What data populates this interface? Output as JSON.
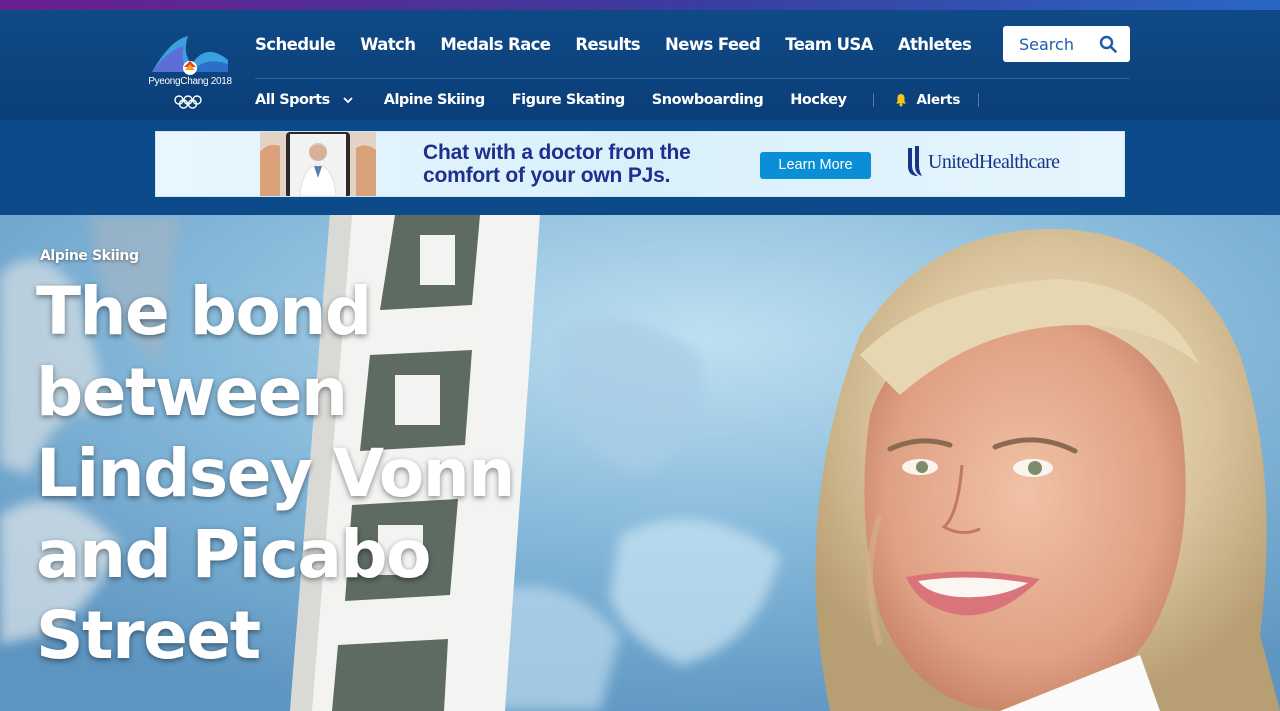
{
  "site": {
    "logo_text": "PyeongChang 2018",
    "colors": {
      "header": "#0b3e78",
      "accent_purple": "#6a1f8f",
      "link_blue": "#1f5ca8"
    }
  },
  "nav": {
    "primary": [
      "Schedule",
      "Watch",
      "Medals Race",
      "Results",
      "News Feed",
      "Team USA",
      "Athletes"
    ],
    "all_sports_label": "All Sports",
    "sports": [
      "Alpine Skiing",
      "Figure Skating",
      "Snowboarding",
      "Hockey"
    ],
    "alerts_label": "Alerts"
  },
  "search": {
    "placeholder": "Search",
    "icon": "search-icon"
  },
  "ad": {
    "headline": "Chat with a doctor from the comfort of your own PJs.",
    "cta": "Learn More",
    "brand": "UnitedHealthcare"
  },
  "hero": {
    "kicker": "Alpine Skiing",
    "title": "The bond between Lindsey Vonn and Picabo Street"
  }
}
